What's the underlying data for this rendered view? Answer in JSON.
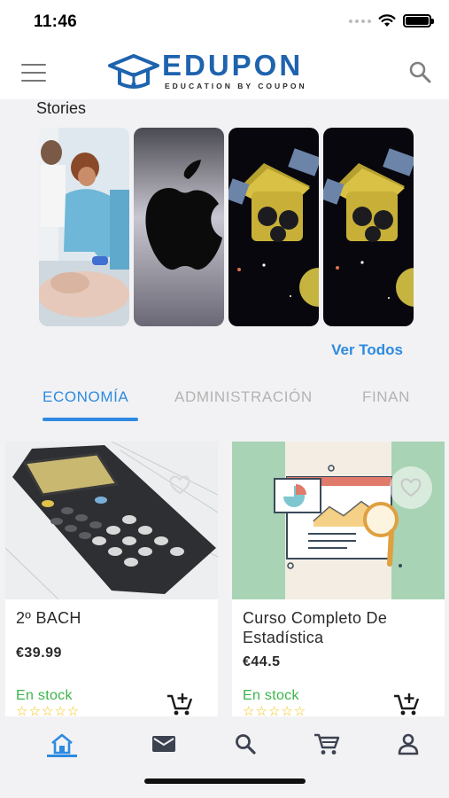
{
  "status_bar": {
    "time": "11:46"
  },
  "header": {
    "logo_text": "EDUPON",
    "logo_tagline": "EDUCATION BY COUPON",
    "colors": {
      "brand": "#1e63ae"
    },
    "icons": {
      "menu": "hamburger-menu-icon",
      "search": "search-icon"
    }
  },
  "stories": {
    "title": "Stories",
    "items": [
      {
        "subject": "medical-training-photo"
      },
      {
        "subject": "apple-logo-photo"
      },
      {
        "subject": "satellite-space-photo"
      },
      {
        "subject": "satellite-space-photo"
      }
    ],
    "see_all_label": "Ver Todos"
  },
  "tabs": [
    {
      "label": "ECONOMÍA",
      "active": true
    },
    {
      "label": "ADMINISTRACIÓN",
      "active": false
    },
    {
      "label": "FINAN",
      "active": false
    }
  ],
  "products": [
    {
      "title": "2º BACH",
      "price": "€39.99",
      "stock": "En stock",
      "rating_stars": 5,
      "stars": "☆☆☆☆☆",
      "image": "graphing-calculator-photo"
    },
    {
      "title": "Curso Completo De Estadística",
      "price": "€44.5",
      "stock": "En stock",
      "rating_stars": 5,
      "stars": "☆☆☆☆☆",
      "image": "statistics-report-illustration"
    }
  ],
  "bottom_nav": [
    {
      "icon": "home-icon",
      "active": true
    },
    {
      "icon": "mail-icon",
      "active": false
    },
    {
      "icon": "search-icon",
      "active": false
    },
    {
      "icon": "cart-icon",
      "active": false
    },
    {
      "icon": "user-icon",
      "active": false
    }
  ],
  "colors": {
    "accent": "#2d8ae0",
    "in_stock": "#3bb54a",
    "star": "#f4c20d"
  }
}
